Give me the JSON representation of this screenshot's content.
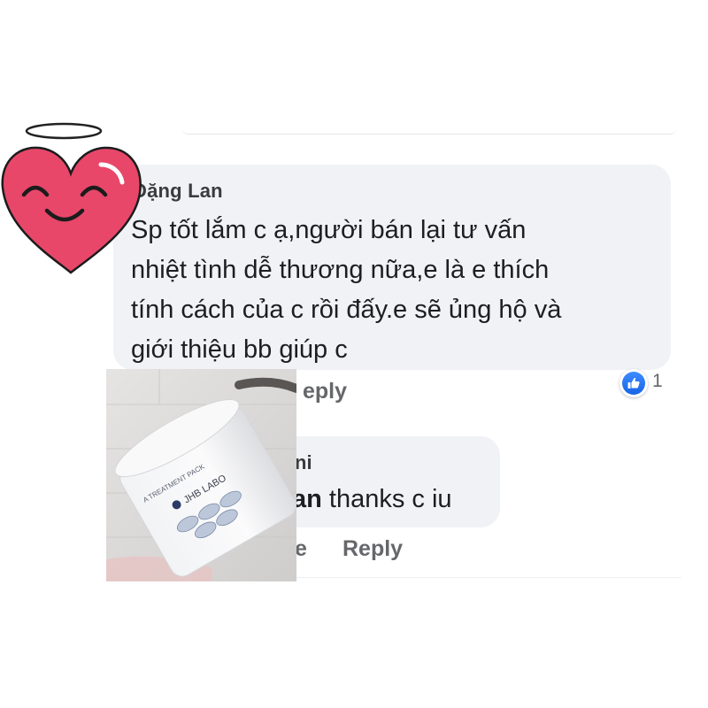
{
  "comment": {
    "author": "Đặng Lan",
    "lines": [
      "Sp tốt lắm c ạ,người bán lại tư vấn",
      "nhiệt tình dễ thương nữa,e là e thích",
      "tính cách của c rồi đấy.e sẽ ủng hộ và",
      "giới thiệu bb giúp c"
    ],
    "reply_label": "Reply",
    "reply_label_partial": "eply",
    "reaction_count": "1",
    "reaction_icon": "like-thumbs-up-icon"
  },
  "reply": {
    "author_partial": "ni",
    "mention_partial": "an",
    "text": " thanks c iu",
    "like_partial": "e",
    "reply_label": "Reply"
  },
  "product": {
    "brand": "JHB LABO",
    "label": "A TREATMENT PACK"
  },
  "colors": {
    "bubble": "#f0f2f5",
    "heart": "#e8476a",
    "like_blue": "#1877f2",
    "muted_text": "#65676b"
  }
}
